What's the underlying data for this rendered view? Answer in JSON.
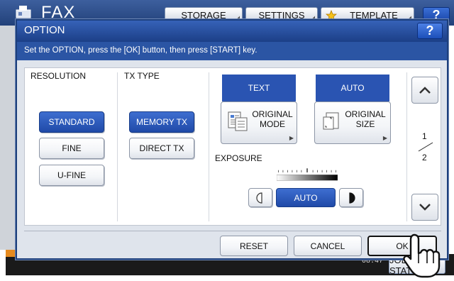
{
  "background": {
    "title": "FAX",
    "tabs": [
      "STORAGE",
      "SETTINGS",
      "TEMPLATE"
    ],
    "help_label": "?",
    "time": "08:47",
    "jobs_label": "JOB STATUS"
  },
  "dialog": {
    "title": "OPTION",
    "help_label": "?",
    "message": "Set the OPTION, press the [OK] button, then press [START] key.",
    "resolution": {
      "label": "RESOLUTION",
      "options": [
        "STANDARD",
        "FINE",
        "U-FINE"
      ],
      "selected": "STANDARD"
    },
    "tx_type": {
      "label": "TX TYPE",
      "options": [
        "MEMORY TX",
        "DIRECT TX"
      ],
      "selected": "MEMORY TX"
    },
    "original_mode": {
      "value": "TEXT",
      "button_line1": "ORIGINAL",
      "button_line2": "MODE"
    },
    "original_size": {
      "value": "AUTO",
      "button_line1": "ORIGINAL",
      "button_line2": "SIZE"
    },
    "exposure": {
      "label": "EXPOSURE",
      "value": "AUTO"
    },
    "pager": {
      "current": "1",
      "total": "2"
    },
    "footer": {
      "reset": "RESET",
      "cancel": "CANCEL",
      "ok": "OK"
    }
  },
  "colors": {
    "accent": "#2a54b2",
    "header": "#1c3f87",
    "panel_bg": "#dfe4ec"
  },
  "icons": [
    "fax-machine-icon",
    "star-icon",
    "original-mode-icon",
    "original-size-icon",
    "chevron-up-icon",
    "chevron-down-icon",
    "exposure-lighter-icon",
    "exposure-darker-icon",
    "hand-pointer-icon"
  ]
}
